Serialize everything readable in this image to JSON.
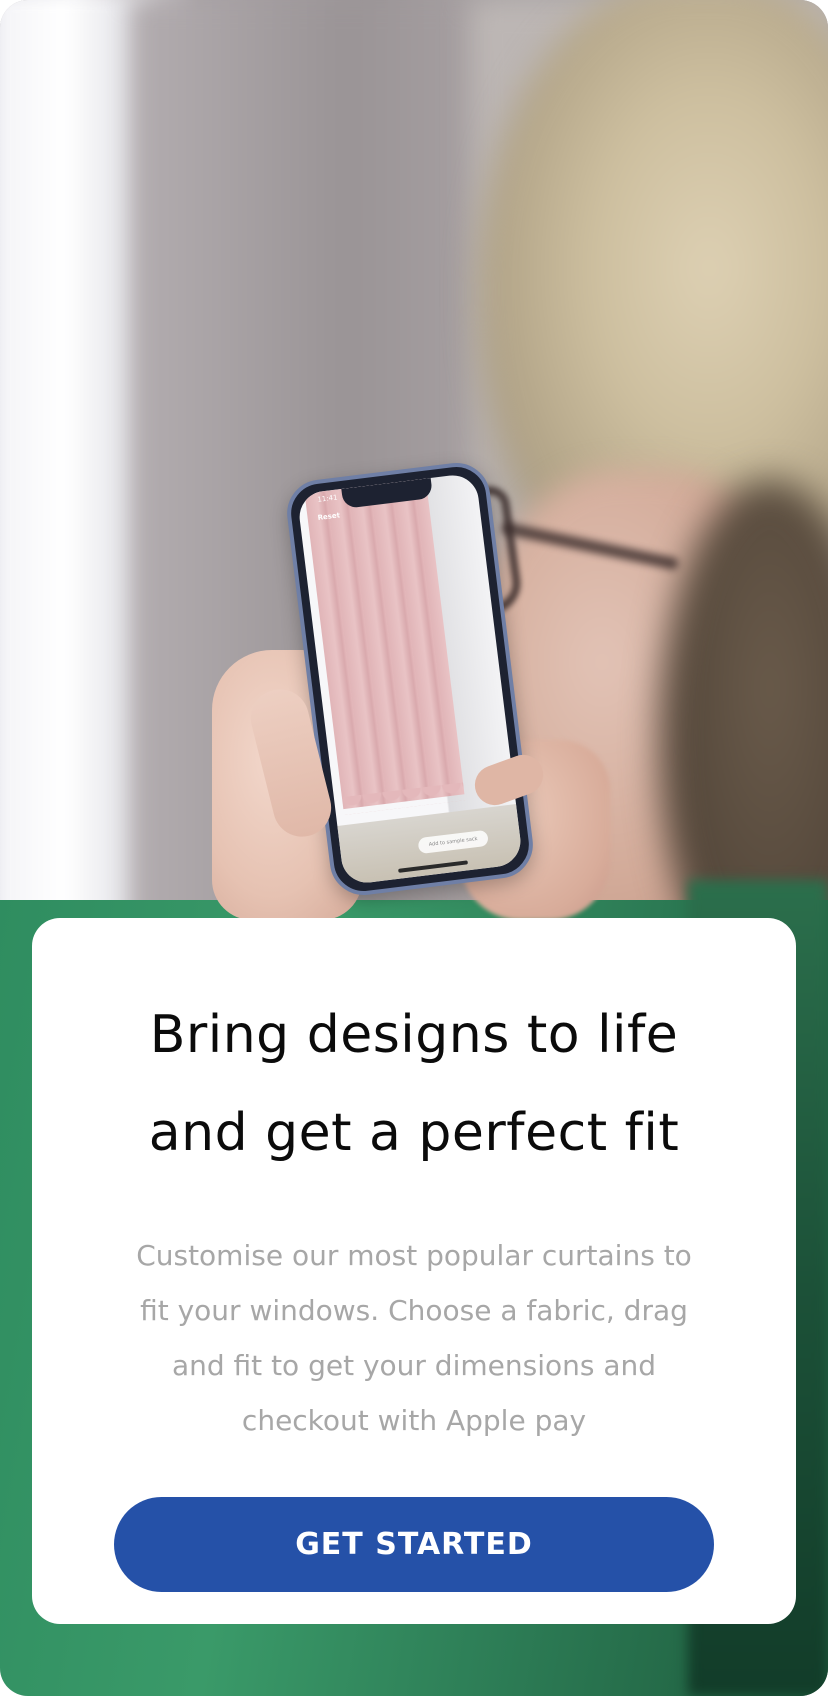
{
  "background_photo": {
    "phone_screen": {
      "time": "11:41",
      "reset_label": "Reset",
      "pill_label": "Add to sample sack"
    }
  },
  "onboarding_card": {
    "title": "Bring designs to life and get a perfect fit",
    "body": "Customise our most popular curtains to\nfit your windows. Choose a fabric, drag\nand fit to get your dimensions  and\ncheckout with Apple pay",
    "cta_label": "GET STARTED"
  },
  "colors": {
    "accent": "#2551a8",
    "card_background": "#ffffff",
    "title_text": "#0b0b0b",
    "body_text": "#a7a7a7"
  }
}
